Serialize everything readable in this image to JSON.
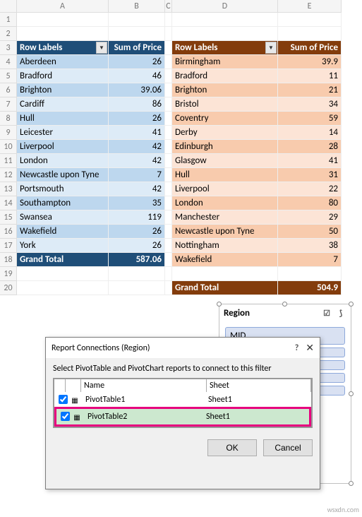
{
  "columns": [
    "A",
    "B",
    "C",
    "D",
    "E"
  ],
  "left": {
    "hdr_rows": "Row Labels",
    "hdr_sum": "Sum of Price",
    "rows": [
      {
        "label": "Aberdeen",
        "val": "26"
      },
      {
        "label": "Bradford",
        "val": "46"
      },
      {
        "label": "Brighton",
        "val": "39.06"
      },
      {
        "label": "Cardiff",
        "val": "86"
      },
      {
        "label": "Hull",
        "val": "26"
      },
      {
        "label": "Leicester",
        "val": "41"
      },
      {
        "label": "Liverpool",
        "val": "42"
      },
      {
        "label": "London",
        "val": "42"
      },
      {
        "label": "Newcastle upon Tyne",
        "val": "7"
      },
      {
        "label": "Portsmouth",
        "val": "42"
      },
      {
        "label": "Southampton",
        "val": "35"
      },
      {
        "label": "Swansea",
        "val": "119"
      },
      {
        "label": "Wakefield",
        "val": "26"
      },
      {
        "label": "York",
        "val": "26"
      }
    ],
    "total_label": "Grand Total",
    "total_val": "587.06"
  },
  "right": {
    "hdr_rows": "Row Labels",
    "hdr_sum": "Sum of Price",
    "rows": [
      {
        "label": "Birmingham",
        "val": "39.9"
      },
      {
        "label": "Bradford",
        "val": "11"
      },
      {
        "label": "Brighton",
        "val": "21"
      },
      {
        "label": "Bristol",
        "val": "34"
      },
      {
        "label": "Coventry",
        "val": "59"
      },
      {
        "label": "Derby",
        "val": "14"
      },
      {
        "label": "Edinburgh",
        "val": "28"
      },
      {
        "label": "Glasgow",
        "val": "41"
      },
      {
        "label": "Hull",
        "val": "31"
      },
      {
        "label": "Liverpool",
        "val": "22"
      },
      {
        "label": "London",
        "val": "80"
      },
      {
        "label": "Manchester",
        "val": "29"
      },
      {
        "label": "Newcastle upon Tyne",
        "val": "50"
      },
      {
        "label": "Nottingham",
        "val": "38"
      },
      {
        "label": "Wakefield",
        "val": "7"
      }
    ],
    "total_label": "Grand Total",
    "total_val": "504.9"
  },
  "slicer": {
    "title": "Region",
    "items": [
      "MID"
    ]
  },
  "dialog": {
    "title": "Report Connections (Region)",
    "msg": "Select PivotTable and PivotChart reports to connect to this filter",
    "col_name": "Name",
    "col_sheet": "Sheet",
    "rows": [
      {
        "checked": true,
        "name": "PivotTable1",
        "sheet": "Sheet1",
        "selected": false
      },
      {
        "checked": true,
        "name": "PivotTable2",
        "sheet": "Sheet1",
        "selected": true
      }
    ],
    "ok": "OK",
    "cancel": "Cancel"
  },
  "watermark": "wsxdn.com"
}
